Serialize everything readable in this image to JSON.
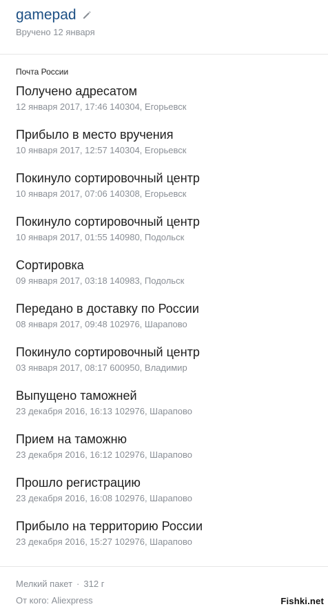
{
  "header": {
    "title": "gamepad",
    "subtitle": "Вручено 12 января",
    "edit_icon": "pencil-icon"
  },
  "carrier": "Почта России",
  "events": [
    {
      "status": "Получено адресатом",
      "meta": "12 января 2017, 17:46 140304, Егорьевск"
    },
    {
      "status": "Прибыло в место вручения",
      "meta": "10 января 2017, 12:57 140304, Егорьевск"
    },
    {
      "status": "Покинуло сортировочный центр",
      "meta": "10 января 2017, 07:06 140308, Егорьевск"
    },
    {
      "status": "Покинуло сортировочный центр",
      "meta": "10 января 2017, 01:55 140980, Подольск"
    },
    {
      "status": "Сортировка",
      "meta": "09 января 2017, 03:18 140983, Подольск"
    },
    {
      "status": "Передано в доставку по России",
      "meta": "08 января 2017, 09:48 102976, Шарапово"
    },
    {
      "status": "Покинуло сортировочный центр",
      "meta": "03 января 2017, 08:17 600950, Владимир"
    },
    {
      "status": "Выпущено таможней",
      "meta": "23 декабря 2016, 16:13 102976, Шарапово"
    },
    {
      "status": "Прием на таможню",
      "meta": "23 декабря 2016, 16:12 102976, Шарапово"
    },
    {
      "status": "Прошло регистрацию",
      "meta": "23 декабря 2016, 16:08 102976, Шарапово"
    },
    {
      "status": "Прибыло на территорию России",
      "meta": "23 декабря 2016, 15:27 102976, Шарапово"
    }
  ],
  "footer": {
    "package_type": "Мелкий пакет",
    "separator": "·",
    "weight": "312 г",
    "sender": "От кого: Aliexpress"
  },
  "watermark": "Fishki.net",
  "colors": {
    "title": "#1c4f84",
    "meta": "#8a8f96",
    "divider": "#e6e6e6"
  }
}
